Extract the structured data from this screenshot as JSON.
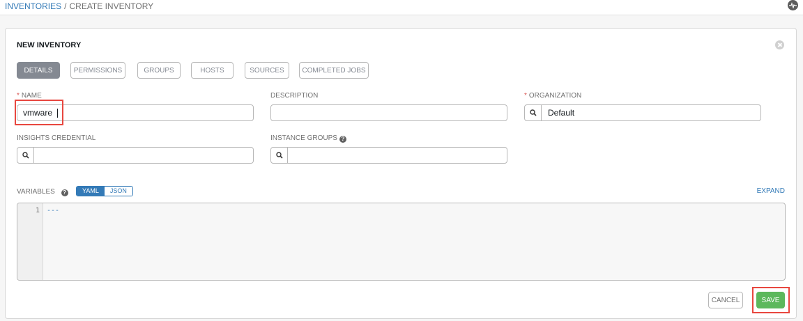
{
  "breadcrumb": {
    "parent": "INVENTORIES",
    "separator": "/",
    "current": "CREATE INVENTORY"
  },
  "header": {
    "activity_icon": "activity-stream-icon"
  },
  "form": {
    "title": "NEW INVENTORY",
    "close_icon": "close-icon",
    "tabs": [
      {
        "label": "DETAILS",
        "active": true
      },
      {
        "label": "PERMISSIONS",
        "active": false
      },
      {
        "label": "GROUPS",
        "active": false
      },
      {
        "label": "HOSTS",
        "active": false
      },
      {
        "label": "SOURCES",
        "active": false
      },
      {
        "label": "COMPLETED JOBS",
        "active": false
      }
    ],
    "fields": {
      "name": {
        "label": "NAME",
        "required_marker": "*",
        "value": "vmware"
      },
      "description": {
        "label": "DESCRIPTION",
        "value": ""
      },
      "organization": {
        "label": "ORGANIZATION",
        "required_marker": "*",
        "value": "Default",
        "icon": "search-icon"
      },
      "insights_credential": {
        "label": "INSIGHTS CREDENTIAL",
        "value": "",
        "icon": "search-icon"
      },
      "instance_groups": {
        "label": "INSTANCE GROUPS",
        "value": "",
        "icon": "search-icon",
        "help_icon": "question-circle-icon"
      }
    },
    "variables": {
      "label": "VARIABLES",
      "help_icon": "question-circle-icon",
      "modes": [
        "YAML",
        "JSON"
      ],
      "active_mode": "YAML",
      "expand_label": "EXPAND",
      "lines": [
        {
          "number": "1",
          "text": "---"
        }
      ]
    },
    "actions": {
      "cancel_label": "CANCEL",
      "save_label": "SAVE"
    }
  },
  "colors": {
    "link": "#337ab7",
    "required": "#d9534f",
    "highlight": "#e8473f",
    "save": "#5cb85c",
    "active_tab": "#848992"
  }
}
